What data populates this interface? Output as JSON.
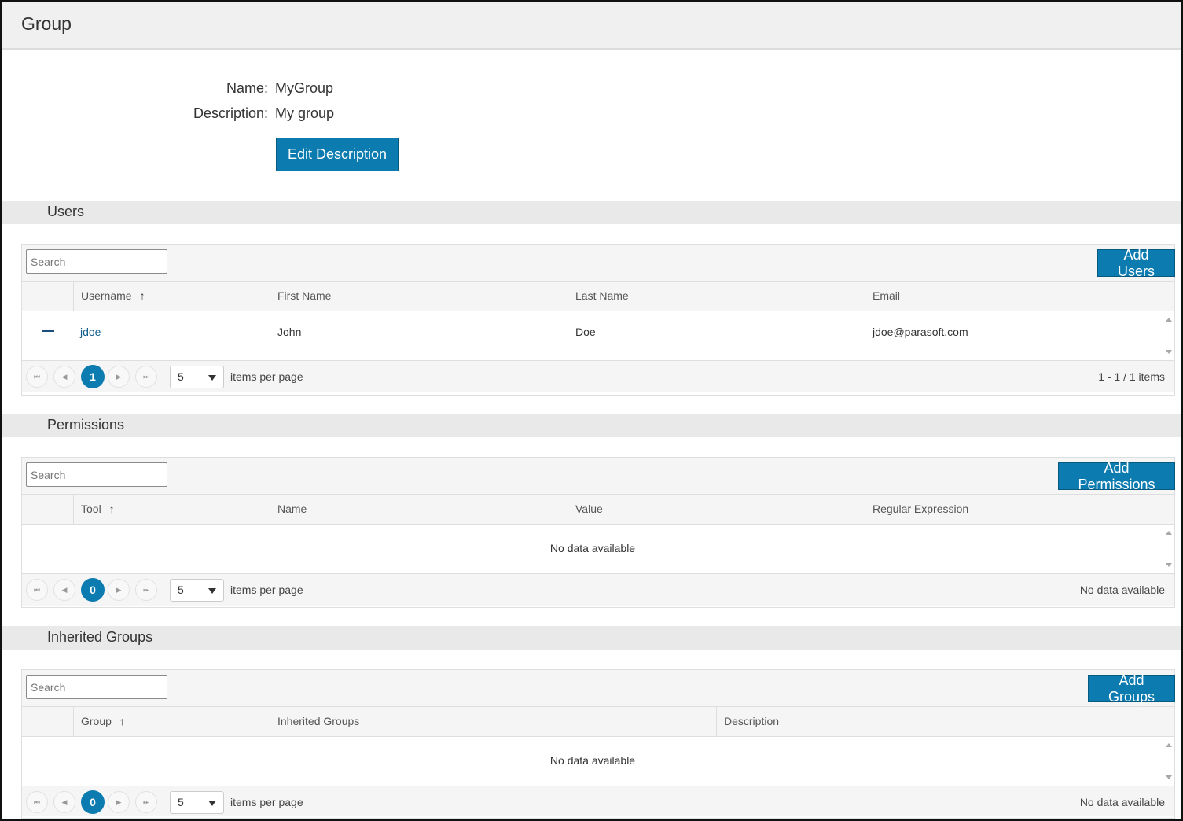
{
  "page": {
    "title": "Group"
  },
  "details": {
    "name_label": "Name:",
    "name_value": "MyGroup",
    "description_label": "Description:",
    "description_value": "My group",
    "edit_button": "Edit Description"
  },
  "users": {
    "section_title": "Users",
    "search_placeholder": "Search",
    "add_button": "Add Users",
    "columns": [
      "Username",
      "First Name",
      "Last Name",
      "Email"
    ],
    "sort_icon": "↑",
    "rows": [
      {
        "username": "jdoe",
        "first_name": "John",
        "last_name": "Doe",
        "email": "jdoe@parasoft.com"
      }
    ],
    "pager": {
      "current_page": "1",
      "page_size": "5",
      "per_page_label": "items per page",
      "info": "1 - 1 / 1 items"
    }
  },
  "permissions": {
    "section_title": "Permissions",
    "search_placeholder": "Search",
    "add_button": "Add Permissions",
    "columns": [
      "Tool",
      "Name",
      "Value",
      "Regular Expression"
    ],
    "sort_icon": "↑",
    "empty_message": "No data available",
    "pager": {
      "current_page": "0",
      "page_size": "5",
      "per_page_label": "items per page",
      "info": "No data available"
    }
  },
  "inherited_groups": {
    "section_title": "Inherited Groups",
    "search_placeholder": "Search",
    "add_button": "Add Groups",
    "columns": [
      "Group",
      "Inherited Groups",
      "Description"
    ],
    "sort_icon": "↑",
    "empty_message": "No data available",
    "pager": {
      "current_page": "0",
      "page_size": "5",
      "per_page_label": "items per page",
      "info": "No data available"
    }
  },
  "pager_icons": {
    "first": "⏮",
    "prev": "◀",
    "next": "▶",
    "last": "⏭"
  },
  "colors": {
    "accent": "#0c7bb0",
    "header_bg": "#f0f0f0",
    "section_bg": "#e9e9e9",
    "link": "#0c5d8c"
  }
}
